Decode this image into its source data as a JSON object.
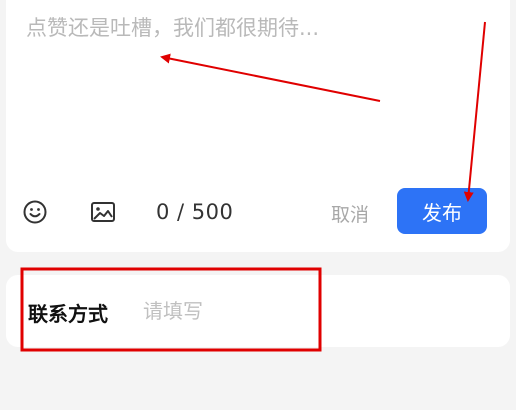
{
  "comment": {
    "placeholder": "点赞还是吐槽，我们都很期待...",
    "value": ""
  },
  "toolbar": {
    "emoji_icon": "emoji-icon",
    "image_icon": "image-icon",
    "counter": "0 / 500",
    "cancel_label": "取消",
    "publish_label": "发布"
  },
  "contact": {
    "label": "联系方式",
    "placeholder": "请填写",
    "value": ""
  },
  "colors": {
    "background": "#f4f4f4",
    "card": "#ffffff",
    "accent": "#2d73f6",
    "annotation": "#e00000"
  }
}
